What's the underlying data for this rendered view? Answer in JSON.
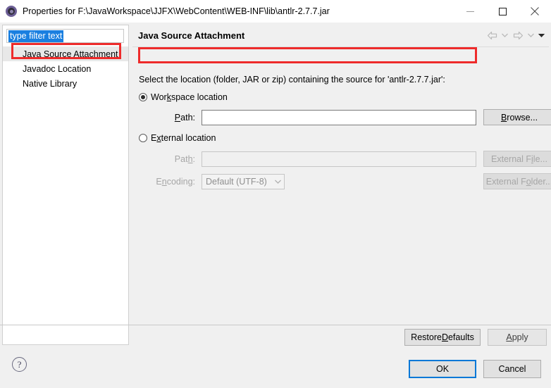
{
  "window": {
    "title": "Properties for F:\\JavaWorkspace\\JJFX\\WebContent\\WEB-INF\\lib\\antlr-2.7.7.jar",
    "app_icon": "eclipse-icon",
    "controls": {
      "minimize": "minimize-icon",
      "maximize": "maximize-icon",
      "close": "close-icon"
    }
  },
  "sidebar": {
    "filter": {
      "value": "type filter text",
      "placeholder": "type filter text"
    },
    "items": [
      {
        "label": "Java Source Attachment",
        "selected": true
      },
      {
        "label": "Javadoc Location",
        "selected": false
      },
      {
        "label": "Native Library",
        "selected": false
      }
    ]
  },
  "content": {
    "title": "Java Source Attachment",
    "nav": {
      "back": "back-arrow-icon",
      "back_menu": "chevron-down-icon",
      "forward": "forward-arrow-icon",
      "forward_menu": "chevron-down-icon",
      "view_menu": "chevron-down-icon"
    },
    "description": "Select the location (folder, JAR or zip) containing the source for 'antlr-2.7.7.jar':",
    "workspace": {
      "radio_label_pre": "Wor",
      "radio_label_mnemonic": "k",
      "radio_label_post": "space location",
      "selected": true,
      "path_label_mnemonic": "P",
      "path_label_post": "ath:",
      "path_value": "",
      "browse_pre": "",
      "browse_mnemonic": "B",
      "browse_post": "rowse..."
    },
    "external": {
      "radio_label_pre": "E",
      "radio_label_mnemonic": "x",
      "radio_label_post": "ternal location",
      "selected": false,
      "path_label_pre": "Pat",
      "path_label_mnemonic": "h",
      "path_label_post": ":",
      "path_value": "",
      "encoding_label_pre": "E",
      "encoding_label_mnemonic": "n",
      "encoding_label_post": "coding:",
      "encoding_value": "Default (UTF-8)",
      "encoding_caret": "chevron-down-icon",
      "file_btn_pre": "External F",
      "file_btn_mnemonic": "i",
      "file_btn_post": "le...",
      "folder_btn_pre": "External F",
      "folder_btn_mnemonic": "o",
      "folder_btn_post": "lder...",
      "disabled": true
    },
    "restore_pre": "Restore ",
    "restore_mnemonic": "D",
    "restore_post": "efaults",
    "apply_pre": "",
    "apply_mnemonic": "A",
    "apply_post": "pply"
  },
  "footer": {
    "help_icon": "help-icon",
    "help_glyph": "?",
    "ok_label": "OK",
    "cancel_label": "Cancel"
  },
  "colors": {
    "annotation_red": "#ee2b2b",
    "selection_blue": "#1a7fe0",
    "focus_blue": "#0078d7",
    "dialog_bg": "#f0f0f0"
  }
}
